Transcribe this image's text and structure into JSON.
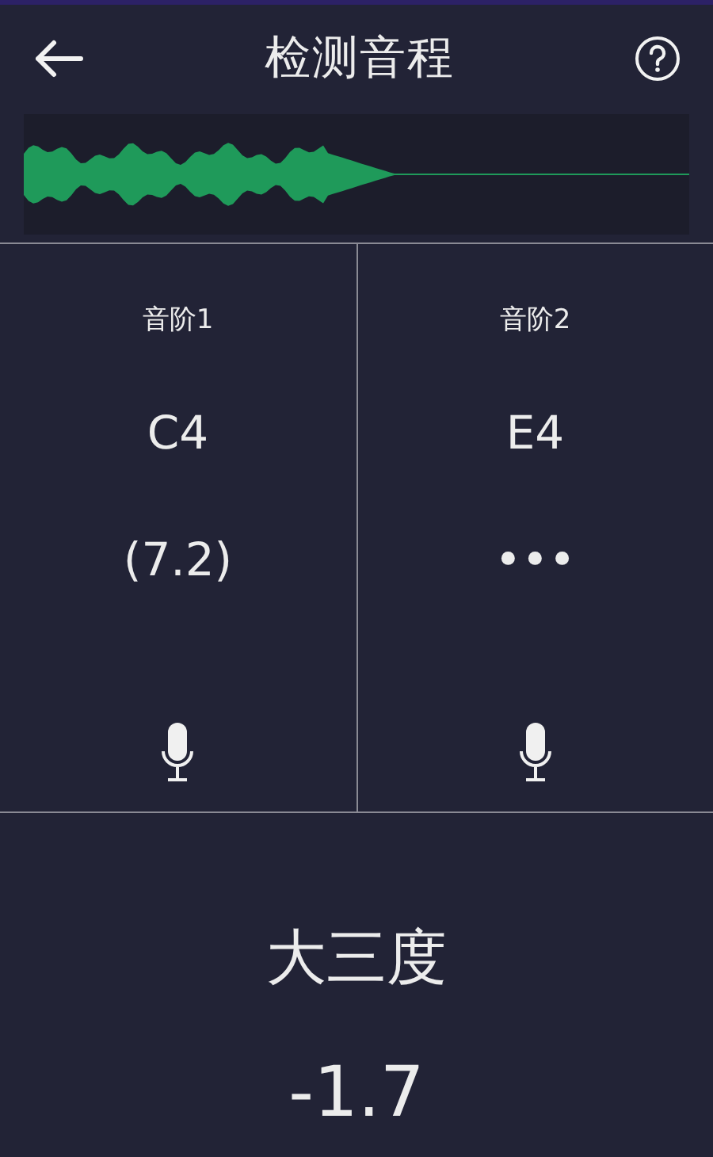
{
  "header": {
    "title": "检测音程"
  },
  "scales": [
    {
      "label": "音阶1",
      "note": "C4",
      "reading": "(7.2)"
    },
    {
      "label": "音阶2",
      "note": "E4",
      "reading": "•••"
    }
  ],
  "interval": {
    "name": "大三度",
    "deviation": "-1.7"
  }
}
